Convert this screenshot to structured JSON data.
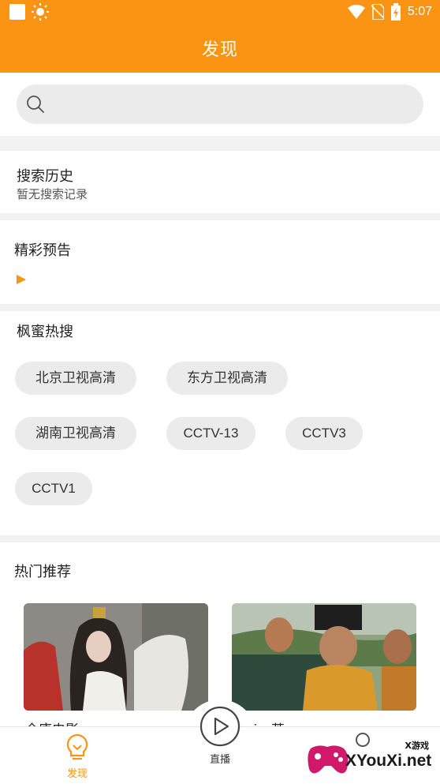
{
  "status_bar": {
    "time": "5:07"
  },
  "header": {
    "title": "发现"
  },
  "search": {
    "placeholder": ""
  },
  "history": {
    "title": "搜索历史",
    "empty_text": "暂无搜索记录"
  },
  "preview": {
    "title": "精彩预告"
  },
  "hot_search": {
    "title": "枫蜜热搜",
    "tags": [
      "北京卫视高清",
      "东方卫视高清",
      "湖南卫视高清",
      "CCTV-13",
      "CCTV3",
      "CCTV1"
    ]
  },
  "recommend": {
    "title": "热门推荐",
    "items": [
      {
        "caption": "全唐电影"
      },
      {
        "caption": "五…英"
      }
    ]
  },
  "tabs": [
    {
      "label": "发现",
      "icon": "bulb-icon"
    },
    {
      "label": "直播",
      "icon": "play-circle-icon"
    }
  ],
  "watermark": {
    "badge": "X游戏",
    "text": "XYouXi.net"
  },
  "colors": {
    "accent": "#fb9313",
    "chip_bg": "#ebebeb"
  }
}
